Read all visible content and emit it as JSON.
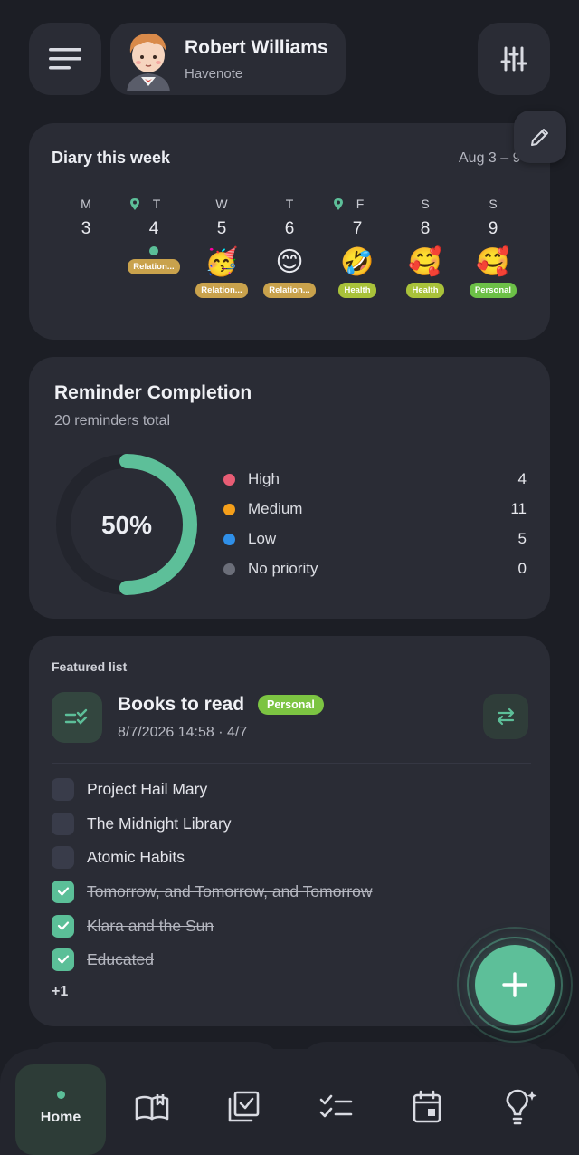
{
  "header": {
    "user_name": "Robert Williams",
    "app_name": "Havenote"
  },
  "diary": {
    "title": "Diary this week",
    "range": "Aug 3 – 9",
    "days": [
      {
        "dow": "M",
        "date": "3",
        "pin": false,
        "emoji": "",
        "tag": "",
        "tag_color": ""
      },
      {
        "dow": "T",
        "date": "4",
        "pin": true,
        "emoji": "",
        "tag": "Relation...",
        "tag_color": "#c9a24c"
      },
      {
        "dow": "W",
        "date": "5",
        "pin": false,
        "emoji": "🥳",
        "tag": "Relation...",
        "tag_color": "#c9a24c"
      },
      {
        "dow": "T",
        "date": "6",
        "pin": false,
        "emoji": "😊",
        "tag": "Relation...",
        "tag_color": "#c9a24c"
      },
      {
        "dow": "F",
        "date": "7",
        "pin": true,
        "emoji": "🤣",
        "tag": "Health",
        "tag_color": "#a9c23a"
      },
      {
        "dow": "S",
        "date": "8",
        "pin": false,
        "emoji": "🥰",
        "tag": "Health",
        "tag_color": "#a9c23a"
      },
      {
        "dow": "S",
        "date": "9",
        "pin": false,
        "emoji": "🥰",
        "tag": "Personal",
        "tag_color": "#6cc047"
      }
    ]
  },
  "reminders": {
    "title": "Reminder Completion",
    "subtitle": "20 reminders total",
    "completion_percent": 50,
    "completion_label": "50%",
    "legend": [
      {
        "label": "High",
        "value": "4",
        "color": "#e85d75"
      },
      {
        "label": "Medium",
        "value": "11",
        "color": "#f59f1a"
      },
      {
        "label": "Low",
        "value": "5",
        "color": "#2f8fe8"
      },
      {
        "label": "No priority",
        "value": "0",
        "color": "#6b6e79"
      }
    ],
    "ring_color": "#5dbf99"
  },
  "featured": {
    "label": "Featured list",
    "title": "Books to read",
    "badge": "Personal",
    "meta": "8/7/2026 14:58 · 4/7",
    "items": [
      {
        "text": "Project Hail Mary",
        "done": false
      },
      {
        "text": "The Midnight Library",
        "done": false
      },
      {
        "text": "Atomic Habits",
        "done": false
      },
      {
        "text": "Tomorrow, and Tomorrow, and Tomorrow",
        "done": true
      },
      {
        "text": "Klara and the Sun",
        "done": true
      },
      {
        "text": "Educated",
        "done": true
      }
    ],
    "more": "+1"
  },
  "nav": {
    "home_label": "Home"
  }
}
